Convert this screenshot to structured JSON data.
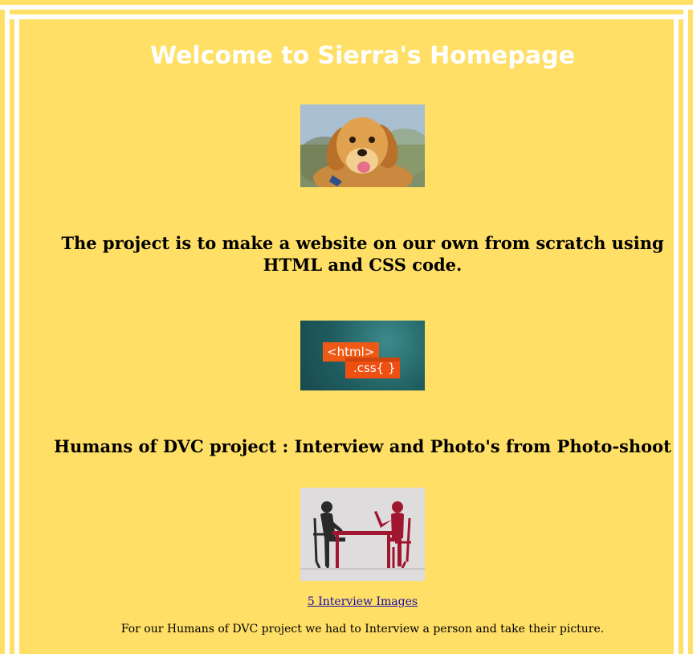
{
  "page": {
    "title": "Welcome to Sierra's Homepage",
    "background_color": "#ffdf66",
    "stripe_color": "#ffffff"
  },
  "sections": {
    "project_heading": "The project is to make a website on our own from scratch using HTML and CSS code.",
    "humans_heading": "Humans of DVC project : Interview and Photo's from Photo-shoot"
  },
  "images": {
    "puppy": "golden-retriever-puppy-photo",
    "code_badge": {
      "line1": "<html>",
      "line2": ".css{ }"
    },
    "interview": "two-people-at-table-illustration"
  },
  "links": {
    "interview_images": "5 Interview Images"
  },
  "body_text": "For our Humans of DVC project we had to Interview a person and take their picture."
}
